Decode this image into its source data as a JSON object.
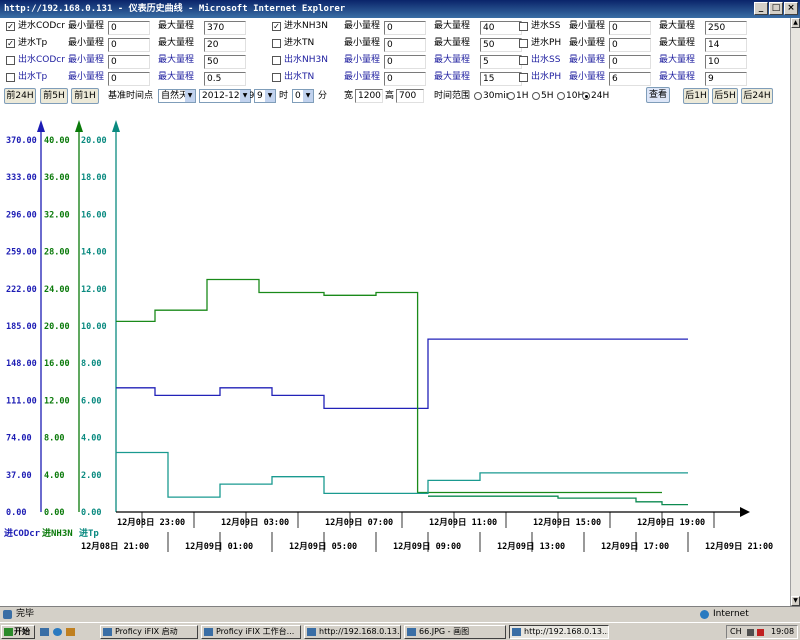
{
  "window": {
    "title": "http://192.168.0.131 - 仪表历史曲线 - Microsoft Internet Explorer",
    "minimize": "_",
    "maximize": "□",
    "close": "×"
  },
  "controls": {
    "rows": [
      {
        "items": [
          {
            "checked": true,
            "name": "进水CODcr",
            "min_label": "最小量程",
            "min": "0",
            "max_label": "最大量程",
            "max": "370"
          },
          {
            "checked": true,
            "name": "进水NH3N",
            "min_label": "最小量程",
            "min": "0",
            "max_label": "最大量程",
            "max": "40"
          },
          {
            "checked": false,
            "name": "进水SS",
            "min_label": "最小量程",
            "min": "0",
            "max_label": "最大量程",
            "max": "250"
          }
        ]
      },
      {
        "items": [
          {
            "checked": true,
            "name": "进水Tp",
            "min_label": "最小量程",
            "min": "0",
            "max_label": "最大量程",
            "max": "20"
          },
          {
            "checked": false,
            "name": "进水TN",
            "min_label": "最小量程",
            "min": "0",
            "max_label": "最大量程",
            "max": "50"
          },
          {
            "checked": false,
            "name": "进水PH",
            "min_label": "最小量程",
            "min": "0",
            "max_label": "最大量程",
            "max": "14"
          }
        ]
      },
      {
        "items": [
          {
            "checked": false,
            "name": "出水CODcr",
            "min_label": "最小量程",
            "min": "0",
            "max_label": "最大量程",
            "max": "50"
          },
          {
            "checked": false,
            "name": "出水NH3N",
            "min_label": "最小量程",
            "min": "0",
            "max_label": "最大量程",
            "max": "5"
          },
          {
            "checked": false,
            "name": "出水SS",
            "min_label": "最小量程",
            "min": "0",
            "max_label": "最大量程",
            "max": "10"
          }
        ]
      },
      {
        "items": [
          {
            "checked": false,
            "name": "出水Tp",
            "min_label": "最小量程",
            "min": "0",
            "max_label": "最大量程",
            "max": "0.5"
          },
          {
            "checked": false,
            "name": "出水TN",
            "min_label": "最小量程",
            "min": "0",
            "max_label": "最大量程",
            "max": "15"
          },
          {
            "checked": false,
            "name": "出水PH",
            "min_label": "最小量程",
            "min": "6",
            "max_label": "最大量程",
            "max": "9"
          }
        ]
      }
    ]
  },
  "nav": {
    "prev24": "前24H",
    "prev5": "前5H",
    "prev1": "前1H",
    "base_label": "基准时间点",
    "period": "自然天",
    "date": "2012-12-09",
    "hour": "9",
    "hour_unit": "时",
    "minute": "0",
    "minute_unit": "分",
    "width_label": "宽",
    "width": "1200",
    "height_label": "高",
    "height": "700",
    "range_label": "时间范围",
    "ranges": [
      {
        "label": "30min",
        "on": false
      },
      {
        "label": "1H",
        "on": false
      },
      {
        "label": "5H",
        "on": false
      },
      {
        "label": "10H",
        "on": false
      },
      {
        "label": "24H",
        "on": true
      }
    ],
    "view": "查看",
    "next1": "后1H",
    "next5": "后5H",
    "next24": "后24H"
  },
  "chart_data": {
    "type": "line",
    "axes": [
      {
        "name": "进CODcr",
        "color": "#1c1cb4",
        "range": [
          0,
          370
        ],
        "ticks": [
          "0.00",
          "37.00",
          "74.00",
          "111.00",
          "148.00",
          "185.00",
          "222.00",
          "259.00",
          "296.00",
          "333.00",
          "370.00"
        ]
      },
      {
        "name": "进NH3N",
        "color": "#0a7a0a",
        "range": [
          0,
          40
        ],
        "ticks": [
          "0.00",
          "4.00",
          "8.00",
          "12.00",
          "16.00",
          "20.00",
          "24.00",
          "28.00",
          "32.00",
          "36.00",
          "40.00"
        ]
      },
      {
        "name": "进Tp",
        "color": "#0a8a80",
        "range": [
          0,
          20
        ],
        "ticks": [
          "0.00",
          "2.00",
          "4.00",
          "6.00",
          "8.00",
          "10.00",
          "12.00",
          "14.00",
          "16.00",
          "18.00",
          "20.00"
        ]
      }
    ],
    "x_range_hours": [
      21,
      45
    ],
    "x_ticks_upper": [
      "12月08日 23:00",
      "12月09日 03:00",
      "12月09日 07:00",
      "12月09日 11:00",
      "12月09日 15:00",
      "12月09日 19:00"
    ],
    "x_ticks_lower": [
      "12月08日 21:00",
      "12月09日 01:00",
      "12月09日 05:00",
      "12月09日 09:00",
      "12月09日 13:00",
      "12月09日 17:00",
      "12月09日 21:00"
    ],
    "series": [
      {
        "name": "进CODcr",
        "color": "#2222b8",
        "axis": 0,
        "points": [
          [
            21,
            123.5
          ],
          [
            22.5,
            123.5
          ],
          [
            22.5,
            116.0
          ],
          [
            25,
            116.0
          ],
          [
            25,
            123.5
          ],
          [
            27,
            123.5
          ],
          [
            27,
            116.0
          ],
          [
            29,
            116.0
          ],
          [
            29,
            103.0
          ],
          [
            33,
            103.0
          ],
          [
            33,
            172.0
          ],
          [
            43,
            172.0
          ]
        ]
      },
      {
        "name": "进NH3N",
        "color": "#1a8a1a",
        "axis": 1,
        "points": [
          [
            21,
            20.5
          ],
          [
            22.5,
            20.5
          ],
          [
            22.5,
            21.7
          ],
          [
            24.5,
            21.7
          ],
          [
            24.5,
            25.0
          ],
          [
            26.5,
            25.0
          ],
          [
            26.5,
            23.6
          ],
          [
            29,
            23.6
          ],
          [
            29,
            23.3
          ],
          [
            31,
            23.3
          ],
          [
            31,
            23.6
          ],
          [
            32.6,
            23.6
          ],
          [
            32.6,
            2.1
          ],
          [
            42,
            2.1
          ]
        ]
      },
      {
        "name": "进Tp",
        "color": "#1a9a90",
        "axis": 2,
        "points": [
          [
            21,
            3.2
          ],
          [
            23,
            3.2
          ],
          [
            23,
            0.8
          ],
          [
            25,
            0.8
          ],
          [
            25,
            1.5
          ],
          [
            27,
            1.5
          ],
          [
            27,
            1.9
          ],
          [
            29,
            1.9
          ],
          [
            29,
            1.0
          ],
          [
            33,
            1.0
          ],
          [
            33,
            1.7
          ],
          [
            35,
            1.7
          ],
          [
            35,
            2.1
          ],
          [
            43,
            2.1
          ]
        ]
      },
      {
        "name": "",
        "color": "#0c8a50",
        "axis": 1,
        "points": [
          [
            33,
            1.7
          ],
          [
            38,
            1.7
          ],
          [
            38,
            1.5
          ],
          [
            41,
            1.5
          ],
          [
            41,
            1.1
          ],
          [
            42,
            1.1
          ],
          [
            42,
            0.8
          ],
          [
            43,
            0.8
          ]
        ]
      }
    ]
  },
  "status": {
    "left": "完毕",
    "zone": "Internet"
  },
  "taskbar": {
    "start": "开始",
    "apps": [
      "Proficy iFIX 启动",
      "Proficy iFIX 工作台...",
      "http://192.168.0.13...",
      "66.JPG - 画图",
      "http://192.168.0.13..."
    ],
    "ime": "CH",
    "clock": "19:08"
  }
}
